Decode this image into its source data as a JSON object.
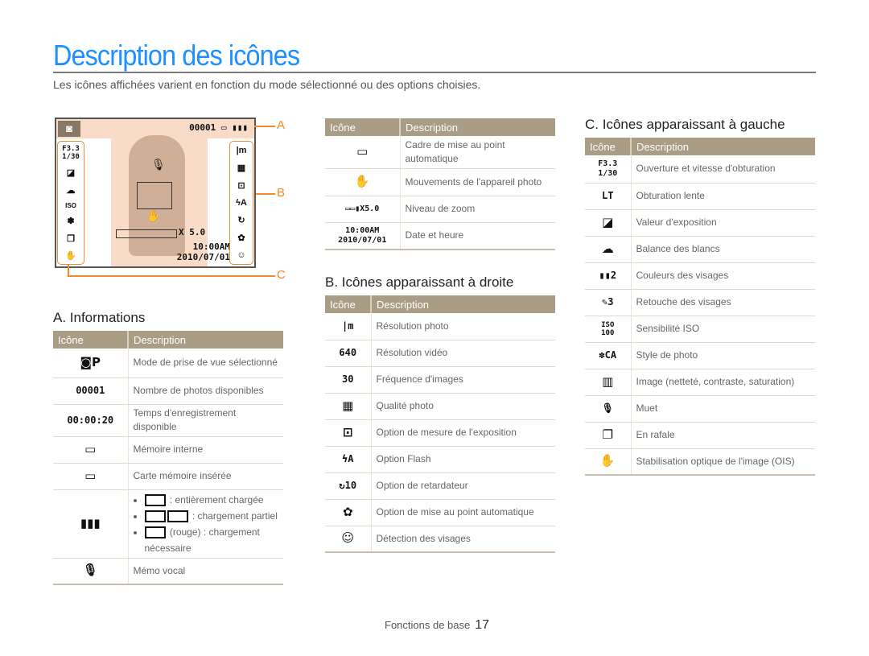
{
  "page": {
    "title": "Description des icônes",
    "subtitle": "Les icônes affichées varient en fonction du mode sélectionné ou des options choisies.",
    "footer_section": "Fonctions de base",
    "footer_page": "17"
  },
  "screen": {
    "counter": "00001",
    "zoom": "X 5.0",
    "time": "10:00AM",
    "date": "2010/07/01",
    "left_icons": [
      "F3.3 1/30",
      "exposure-icon",
      "cloud-icon",
      "iso-icon",
      "photo-style-icon",
      "burst-icon",
      "ois-icon"
    ],
    "right_icons": [
      "1m",
      "quality-icon",
      "metering-icon",
      "flash-auto-icon",
      "timer-icon",
      "macro-icon",
      "face-detect-icon"
    ],
    "callouts": [
      "A",
      "B",
      "C"
    ]
  },
  "sections": {
    "a": {
      "heading": "A. Informations",
      "col_icon": "Icône",
      "col_desc": "Description",
      "rows": [
        {
          "icon": "◙P",
          "desc": "Mode de prise de vue sélectionné"
        },
        {
          "icon": "00001",
          "desc": "Nombre de photos disponibles"
        },
        {
          "icon": "00:00:20",
          "desc": "Temps d'enregistrement disponible"
        },
        {
          "icon": "IN▸",
          "desc": "Mémoire interne"
        },
        {
          "icon": "▭▸",
          "desc": "Carte mémoire insérée"
        },
        {
          "icon": "▮III",
          "bullets": [
            " : entièrement chargée",
            " : chargement partiel",
            " (rouge) : chargement nécessaire"
          ]
        },
        {
          "icon": "🎙",
          "desc": "Mémo vocal"
        }
      ]
    },
    "top_middle": {
      "col_icon": "Icône",
      "col_desc": "Description",
      "rows": [
        {
          "icon": "▭",
          "desc": "Cadre de mise au point automatique"
        },
        {
          "icon": "✋",
          "desc": "Mouvements de l'appareil photo"
        },
        {
          "icon": "▭▭▮X5.0",
          "desc": "Niveau de zoom"
        },
        {
          "icon": "10:00AM 2010/07/01",
          "desc": "Date et heure"
        }
      ]
    },
    "b": {
      "heading": "B. Icônes apparaissant à droite",
      "col_icon": "Icône",
      "col_desc": "Description",
      "rows": [
        {
          "icon": "|m",
          "desc": "Résolution photo"
        },
        {
          "icon": "640",
          "desc": "Résolution vidéo"
        },
        {
          "icon": "30",
          "desc": "Fréquence d'images"
        },
        {
          "icon": "▦F",
          "desc": "Qualité photo"
        },
        {
          "icon": "⊡",
          "desc": "Option de mesure de l'exposition"
        },
        {
          "icon": "ϟA",
          "desc": "Option Flash"
        },
        {
          "icon": "↻10",
          "desc": "Option de retardateur"
        },
        {
          "icon": "✿",
          "desc": "Option de mise au point automatique"
        },
        {
          "icon": "☺",
          "desc": "Détection des visages"
        }
      ]
    },
    "c": {
      "heading": "C. Icônes apparaissant à gauche",
      "col_icon": "Icône",
      "col_desc": "Description",
      "rows": [
        {
          "icon": "F3.3 1/30",
          "desc": "Ouverture et vitesse d'obturation"
        },
        {
          "icon": "LT",
          "desc": "Obturation lente"
        },
        {
          "icon": "◪",
          "desc": "Valeur d'exposition"
        },
        {
          "icon": "☁",
          "desc": "Balance des blancs"
        },
        {
          "icon": "▮▮2",
          "desc": "Couleurs des visages"
        },
        {
          "icon": "✎3",
          "desc": "Retouche des visages"
        },
        {
          "icon": "ISO 100",
          "desc": "Sensibilité ISO"
        },
        {
          "icon": "✽CA",
          "desc": "Style de photo"
        },
        {
          "icon": "▥",
          "desc": "Image (netteté, contraste, saturation)"
        },
        {
          "icon": "🎙OFF",
          "desc": "Muet"
        },
        {
          "icon": "❐",
          "desc": "En rafale"
        },
        {
          "icon": "✋OIS",
          "desc": "Stabilisation optique de l'image (OIS)"
        }
      ]
    }
  }
}
